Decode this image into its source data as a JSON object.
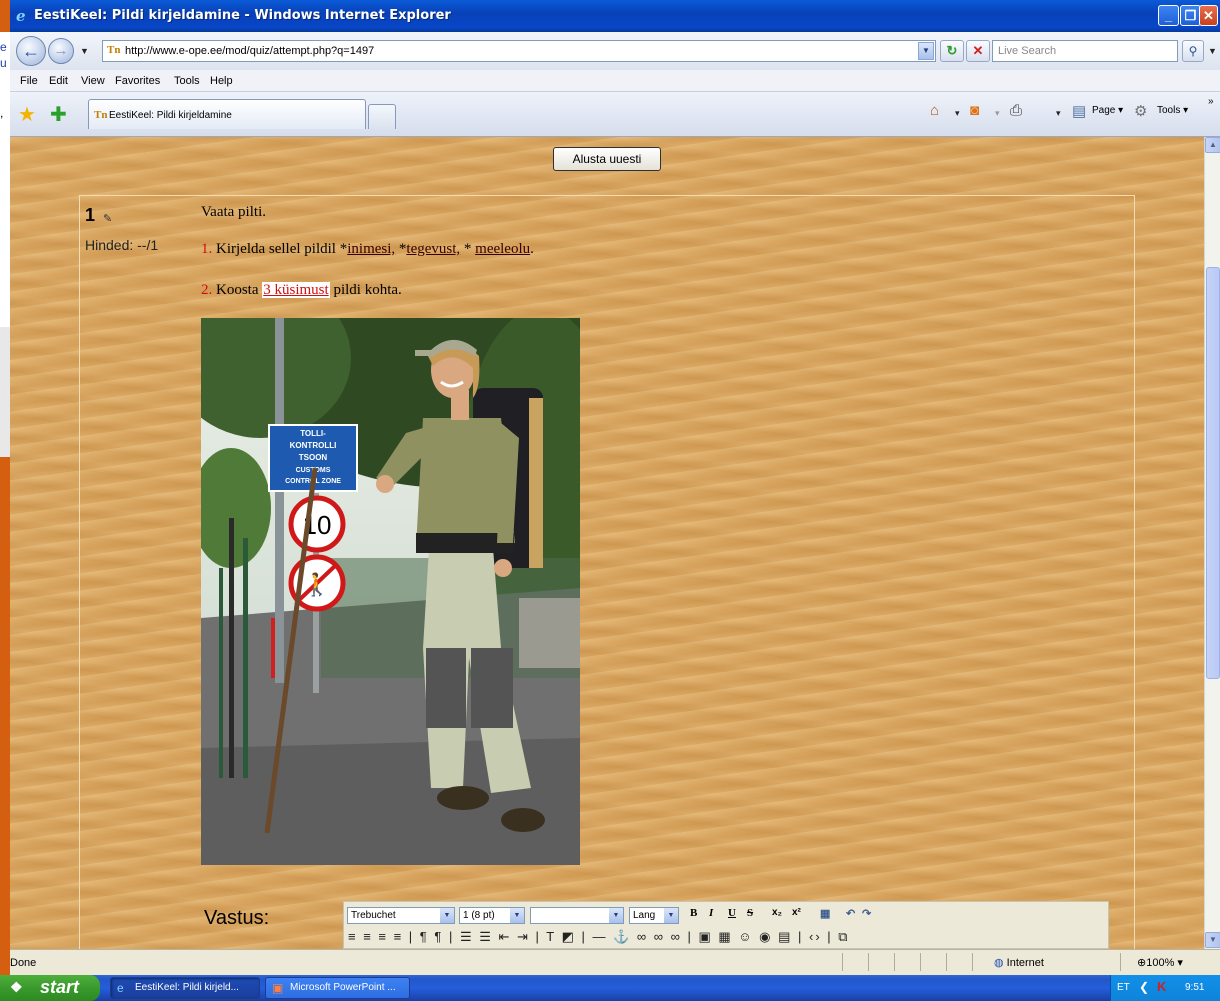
{
  "window": {
    "title": "EestiKeel: Pildi kirjeldamine - Windows Internet Explorer",
    "minimize": "_",
    "maximize": "❐",
    "close": "✕"
  },
  "desktop": {
    "sliver_letters": [
      "e",
      "u",
      ","
    ]
  },
  "address": {
    "url": "http://www.e-ope.ee/mod/quiz/attempt.php?q=1497",
    "search_placeholder": "Live Search"
  },
  "menu": [
    "File",
    "Edit",
    "View",
    "Favorites",
    "Tools",
    "Help"
  ],
  "tab": {
    "label": "EestiKeel: Pildi kirjeldamine"
  },
  "commandbar": {
    "page": "Page ▾",
    "tools": "Tools ▾"
  },
  "page": {
    "restart_button": "Alusta uuesti",
    "question_number": "1",
    "grade": "Hinded: --/1",
    "intro": "Vaata pilti.",
    "item1_num": "1.",
    "item1_pre": " Kirjelda sellel pildil *",
    "item1_link1": "inimesi,",
    "item1_mid1": " *",
    "item1_link2": "tegevust,",
    "item1_mid2": " * ",
    "item1_link3": "meeleolu",
    "item1_end": ".",
    "item2_num": "2.",
    "item2_pre": " Koosta ",
    "item2_link": "3 küsimust",
    "item2_end": " pildi kohta.",
    "answer_label": "Vastus:",
    "sign_text": [
      "TOLLI-",
      "KONTROLLI",
      "TSOON",
      "CUSTOMS",
      "CONTROL ZONE"
    ],
    "speed_sign": "10"
  },
  "editor": {
    "font": "Trebuchet",
    "size": "1 (8 pt)",
    "format": "",
    "lang": "Lang",
    "bold": "B",
    "italic": "I",
    "underline": "U",
    "strike": "S",
    "sub": "x₂",
    "sup": "x²",
    "row2": "≡ ≡ ≡ ≡ | ¶ ¶ | ☰ ☰ ⇤ ⇥ | T ◩ | — ⚓ ∞ ∞ ∞ | ▣ ▦ ☺ ◉ ▤ | ‹› | ⧉"
  },
  "status": {
    "text": "Done",
    "zone": "Internet",
    "zoom": "100%"
  },
  "taskbar": {
    "start": "start",
    "items": [
      "EestiKeel: Pildi kirjeld...",
      "Microsoft PowerPoint ..."
    ],
    "lang": "ET",
    "time": "9:51"
  }
}
